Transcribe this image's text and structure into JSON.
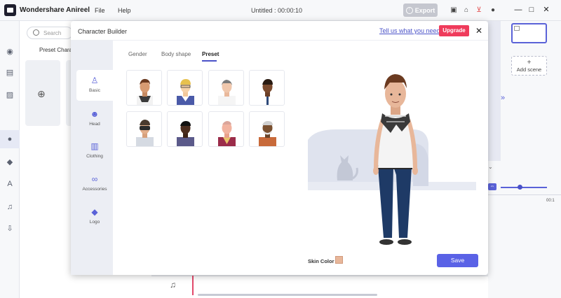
{
  "app": {
    "title": "Wondershare Anireel",
    "menu_file": "File",
    "menu_help": "Help",
    "doc_title": "Untitled : 00:00:10",
    "export_label": "Export"
  },
  "left_panel": {
    "search_placeholder": "Search",
    "preset_tab": "Preset Characte"
  },
  "right_panel": {
    "add_scene_label": "Add scene",
    "ruler_label": "00:1"
  },
  "dialog": {
    "title": "Character Builder",
    "link": "Tell us what you need",
    "upgrade": "Upgrade",
    "sidebar": [
      {
        "label": "Basic",
        "icon": "person-icon"
      },
      {
        "label": "Head",
        "icon": "head-icon"
      },
      {
        "label": "Clothing",
        "icon": "shirt-icon"
      },
      {
        "label": "Accessories",
        "icon": "glasses-icon"
      },
      {
        "label": "Logo",
        "icon": "shapes-icon"
      }
    ],
    "tabs": {
      "gender": "Gender",
      "body_shape": "Body shape",
      "preset": "Preset"
    },
    "skin_color_label": "Skin Color",
    "save": "Save"
  },
  "colors": {
    "accent": "#5a62e6",
    "upgrade": "#ef3b5b",
    "skin": "#e8b79a"
  }
}
